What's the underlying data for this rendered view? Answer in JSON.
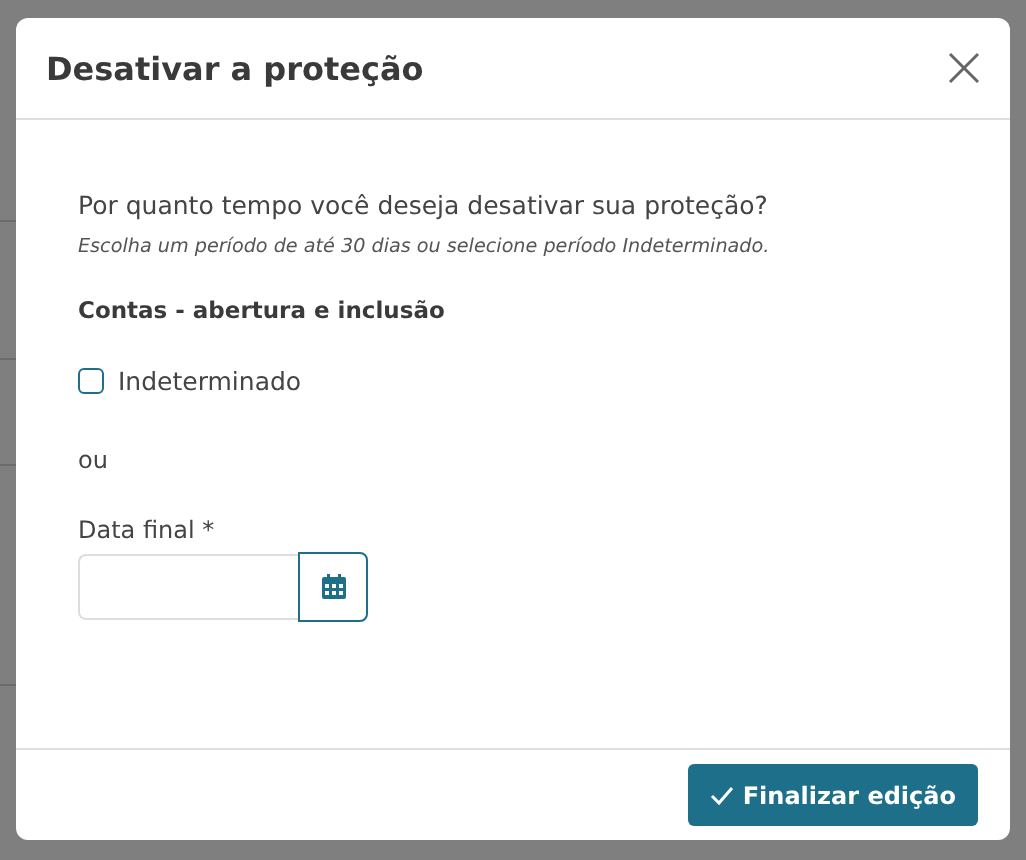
{
  "dialog": {
    "title": "Desativar a proteção",
    "question": "Por quanto tempo você deseja desativar sua proteção?",
    "hint": "Escolha um período de até 30 dias ou selecione período Indeterminado.",
    "section": "Contas - abertura e inclusão",
    "checkbox": {
      "label": "Indeterminado",
      "checked": false
    },
    "separator": "ou",
    "date_field": {
      "label": "Data final *"
    },
    "buttons": [
      {
        "label": "Finalizar edição",
        "kind": "primary"
      }
    ]
  }
}
